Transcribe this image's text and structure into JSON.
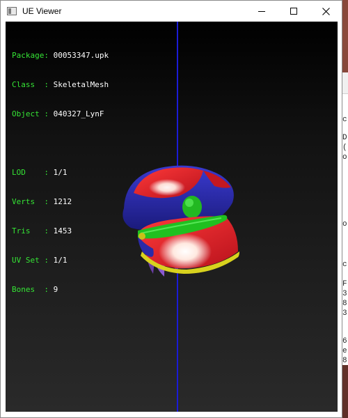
{
  "window": {
    "title": "UE Viewer",
    "controls": [
      "minimize-icon",
      "maximize-icon",
      "close-icon"
    ]
  },
  "info": {
    "package": {
      "label": "Package:",
      "value": "00053347.upk"
    },
    "class": {
      "label": "Class  :",
      "value": "SkeletalMesh"
    },
    "object": {
      "label": "Object :",
      "value": "040327_LynF"
    },
    "lod": {
      "label": "LOD    :",
      "value": "1/1"
    },
    "verts": {
      "label": "Verts  :",
      "value": "1212"
    },
    "tris": {
      "label": "Tris   :",
      "value": "1453"
    },
    "uvset": {
      "label": "UV Set :",
      "value": "1/1"
    },
    "bones": {
      "label": "Bones  :",
      "value": "9"
    }
  },
  "colors": {
    "label_green": "#35e435",
    "value_white": "#ffffff",
    "axis_blue": "#1b1bd6",
    "cap_red": "#e0202a",
    "cap_blue": "#3030b8",
    "cap_green": "#22c422",
    "cap_yellow": "#d8d21e",
    "hair_purple": "#7a4ab8"
  },
  "background_window": {
    "fragments": [
      "c",
      "D",
      "(",
      "o",
      "o",
      "c",
      "F",
      "3",
      "8",
      "3",
      "6",
      "e",
      "8"
    ]
  }
}
